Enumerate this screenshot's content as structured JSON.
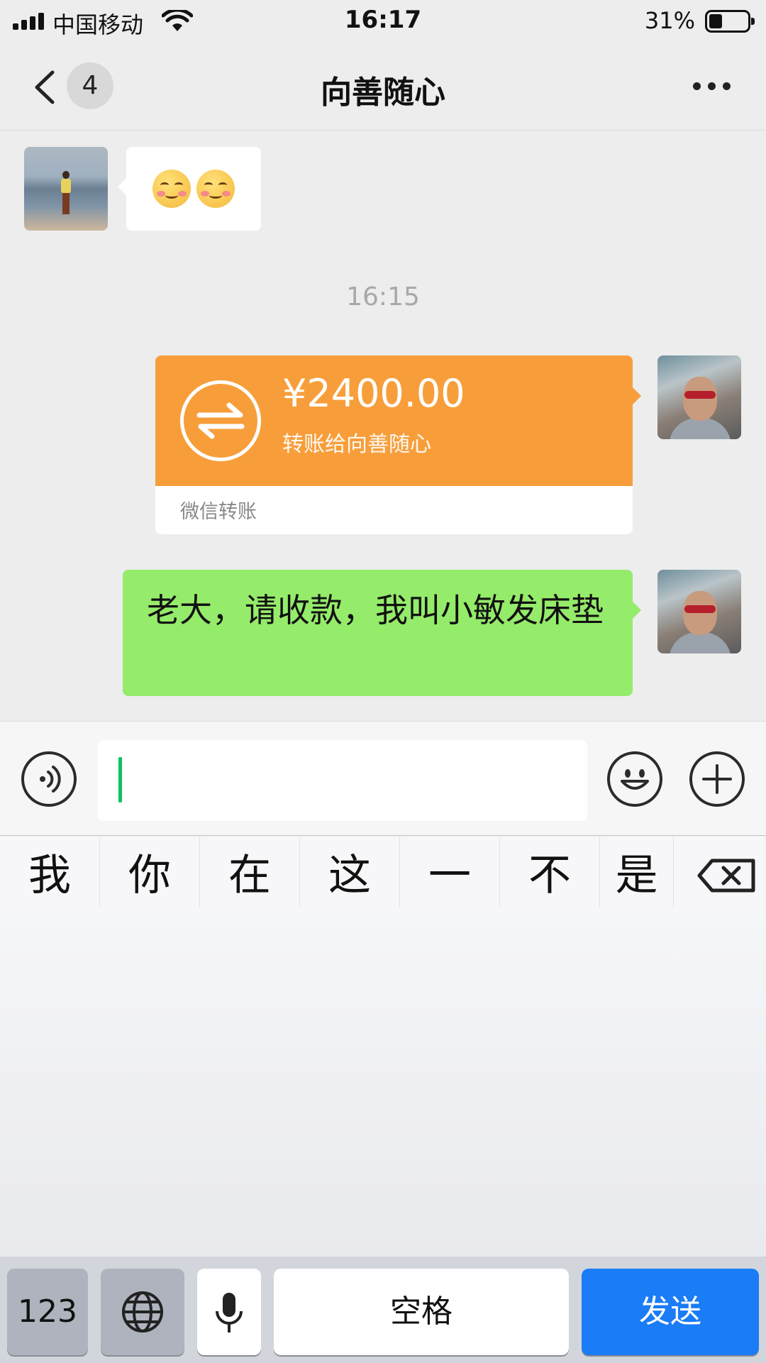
{
  "status_bar": {
    "carrier": "中国移动",
    "time": "16:17",
    "battery_percent": "31%",
    "battery_level": 0.31,
    "signal_bars": 4
  },
  "header": {
    "unread_count": "4",
    "title": "向善随心"
  },
  "messages": {
    "incoming_emoji": {
      "emoji_count": 2,
      "emoji_icon": "blushing-smile-icon"
    },
    "time_divider": "16:15",
    "transfer": {
      "amount": "¥2400.00",
      "description": "转账给向善随心",
      "source": "微信转账"
    },
    "outgoing_text": "老大，请收款，我叫小敏发床垫"
  },
  "input_bar": {
    "text": "",
    "caret_color": "#07c160"
  },
  "candidates": [
    "我",
    "你",
    "在",
    "这",
    "一",
    "不",
    "是"
  ],
  "keyboard": {
    "numbers_label": "123",
    "space_label": "空格",
    "send_label": "发送"
  },
  "colors": {
    "background": "#ededed",
    "transfer_orange": "#f79e3b",
    "sent_bubble_green": "#95eb6a",
    "send_key_blue": "#1a7cf6"
  }
}
